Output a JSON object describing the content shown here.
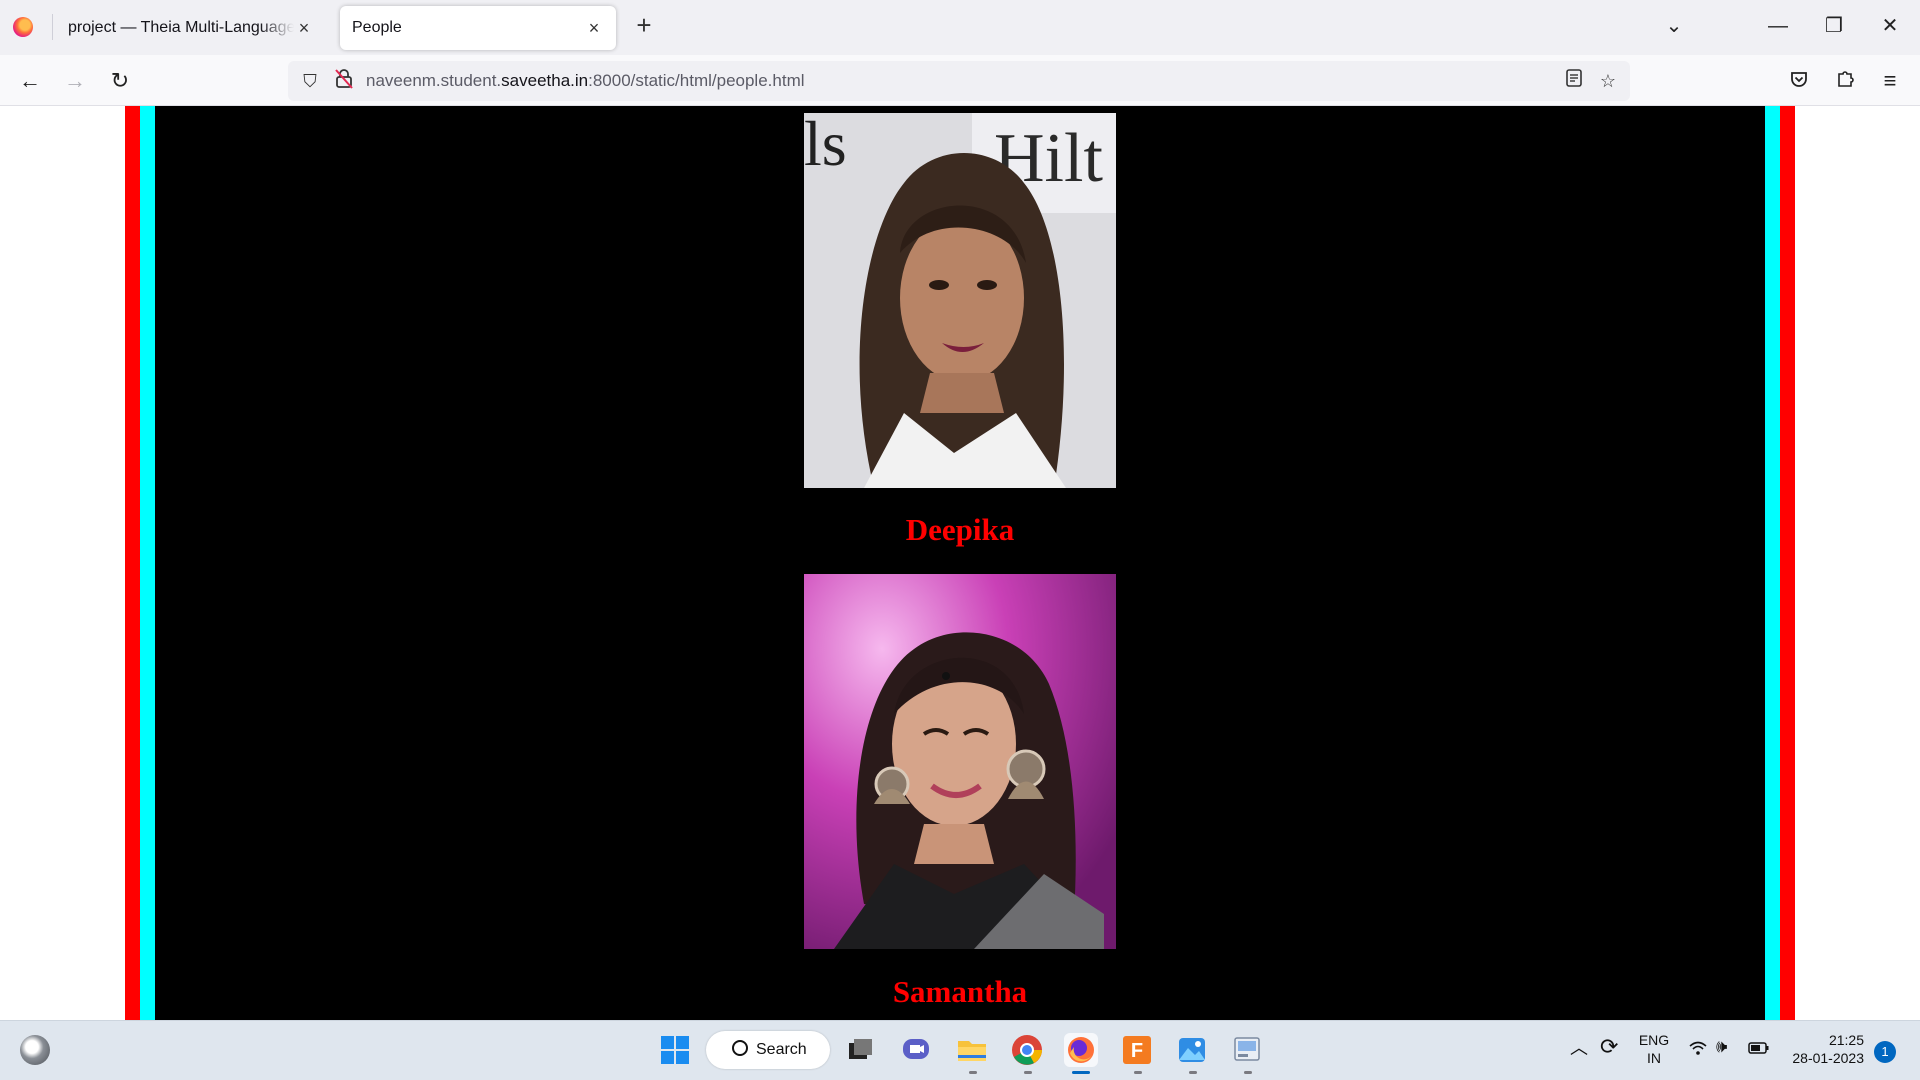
{
  "tabs": [
    {
      "title": "project — Theia Multi-Language Ex",
      "active": false
    },
    {
      "title": "People",
      "active": true
    }
  ],
  "window_controls": {
    "list": "⌄",
    "minimize": "—",
    "restore": "❐",
    "close": "✕"
  },
  "address_bar": {
    "url_prefix": "naveenm.student.",
    "url_domain": "saveetha.in",
    "url_suffix": ":8000/static/html/people.html"
  },
  "page": {
    "frame_colors": {
      "outer": "#ff0000",
      "inner": "#00ffff",
      "background": "#000000"
    },
    "people": [
      {
        "name": "Deepika"
      },
      {
        "name": "Samantha"
      }
    ]
  },
  "taskbar": {
    "search_label": "Search",
    "language_line1": "ENG",
    "language_line2": "IN",
    "time": "21:25",
    "date": "28-01-2023",
    "notification_count": "1"
  }
}
